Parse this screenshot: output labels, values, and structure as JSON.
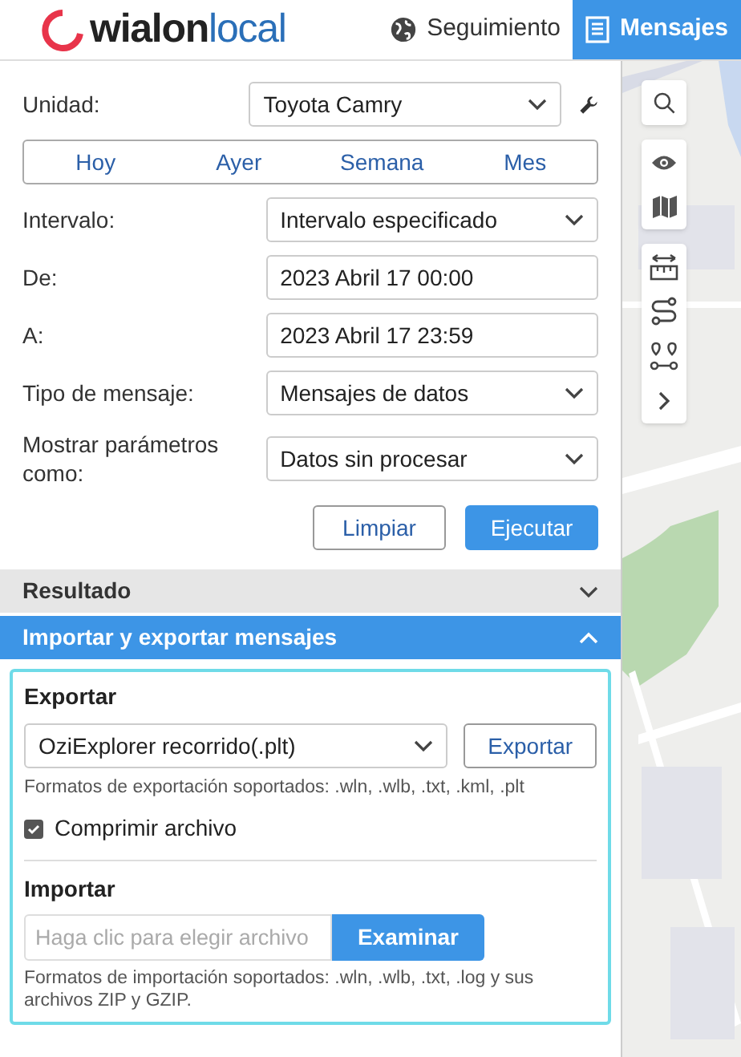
{
  "header": {
    "logo": {
      "part_1": "wialon",
      "part_2": "local"
    },
    "tabs": [
      {
        "label": "Seguimiento",
        "kind": "globe",
        "selected": false
      },
      {
        "label": "Mensajes",
        "kind": "document",
        "selected": true
      }
    ]
  },
  "form": {
    "unit": {
      "label": "Unidad:",
      "value": "Toyota Camry"
    },
    "periods": [
      {
        "label": "Hoy",
        "selected": false
      },
      {
        "label": "Ayer",
        "selected": false
      },
      {
        "label": "Semana",
        "selected": false
      },
      {
        "label": "Mes",
        "selected": false
      }
    ],
    "fields": [
      {
        "kind": "select",
        "label": "Intervalo:",
        "value": "Intervalo especificado"
      },
      {
        "kind": "input",
        "label": "De:",
        "value": "2023 Abril 17 00:00"
      },
      {
        "kind": "input",
        "label": "A:",
        "value": "2023 Abril 17 23:59"
      },
      {
        "kind": "select",
        "label": "Tipo de mensaje:",
        "value": "Mensajes de datos"
      },
      {
        "kind": "select",
        "label": "Mostrar parámetros como:",
        "value": "Datos sin procesar"
      }
    ],
    "buttons": [
      {
        "kind": "secondary",
        "label": "Limpiar"
      },
      {
        "kind": "primary",
        "label": "Ejecutar"
      }
    ]
  },
  "sections": [
    {
      "title": "Resultado",
      "expanded": false
    },
    {
      "title": "Importar y exportar mensajes",
      "expanded": true
    }
  ],
  "export": {
    "heading": "Exportar",
    "format": "OziExplorer recorrido(.plt)",
    "button": "Exportar",
    "note": "Formatos de exportación soportados: .wln, .wlb, .txt, .kml, .plt",
    "compress": {
      "label": "Comprimir archivo",
      "checked": true
    }
  },
  "import": {
    "heading": "Importar",
    "placeholder": "Haga clic para elegir archivo",
    "button": "Examinar",
    "note": "Formatos de importación soportados: .wln, .wlb, .txt, .log y sus archivos ZIP y GZIP."
  }
}
